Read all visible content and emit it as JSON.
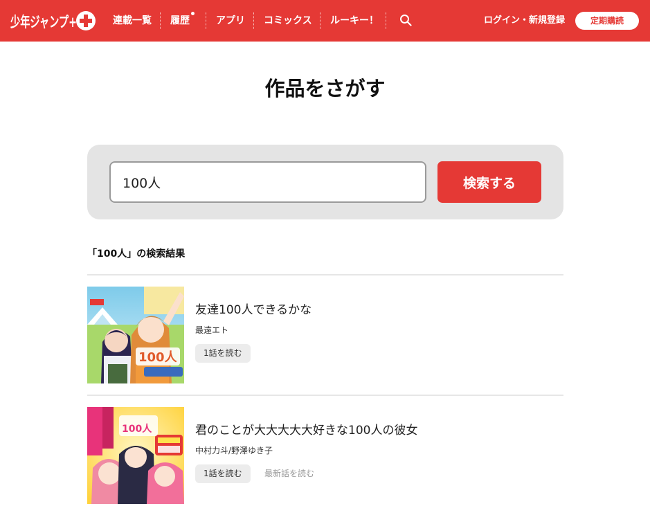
{
  "header": {
    "logo_text": "少年ジャンプ+",
    "nav": [
      "連載一覧",
      "履歴",
      "アプリ",
      "コミックス",
      "ルーキー！"
    ],
    "login_label": "ログイン・新規登録",
    "subscribe_label": "定期購読"
  },
  "page_title": "作品をさがす",
  "search": {
    "value": "100人",
    "button_label": "検索する"
  },
  "results_heading": "「100人」の検索結果",
  "results": [
    {
      "title": "友達100人できるかな",
      "author": "最遠エト",
      "read_label": "1話を読む"
    },
    {
      "title": "君のことが大大大大大好きな100人の彼女",
      "author": "中村力斗/野澤ゆき子",
      "read_label": "1話を読む",
      "latest_label": "最新話を読む"
    }
  ],
  "colors": {
    "brand_red": "#e53935",
    "panel_gray": "#e4e4e4",
    "button_gray": "#ececec"
  }
}
